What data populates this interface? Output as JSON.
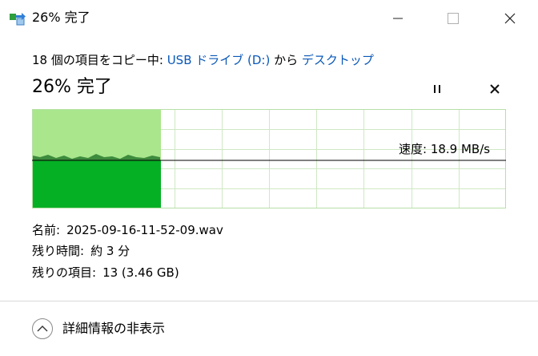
{
  "window": {
    "title": "26% 完了",
    "icon": "file-copy-icon",
    "controls": [
      "minimize-icon",
      "maximize-icon",
      "close-icon"
    ]
  },
  "copy": {
    "prefix": "18 個の項目をコピー中: ",
    "source": "USB ドライブ (D:)",
    "middle": " から ",
    "destination": "デスクトップ",
    "percent_text": "26% 完了",
    "percent": 26
  },
  "graph": {
    "speed_label": "速度: 18.9 MB/s",
    "fill_fraction": 0.27,
    "colors": {
      "light": "#a9e68c",
      "dark": "#06b025",
      "grid": "#cfe8c4",
      "border": "#b7e0a6"
    }
  },
  "details": {
    "name_label": "名前:",
    "name_value": "2025-09-16-11-52-09.wav",
    "time_label": "残り時間:",
    "time_value": "約 3 分",
    "items_label": "残りの項目:",
    "items_value": "13 (3.46 GB)"
  },
  "footer": {
    "toggle_label": "詳細情報の非表示",
    "toggle_icon": "chevron-up-icon"
  }
}
